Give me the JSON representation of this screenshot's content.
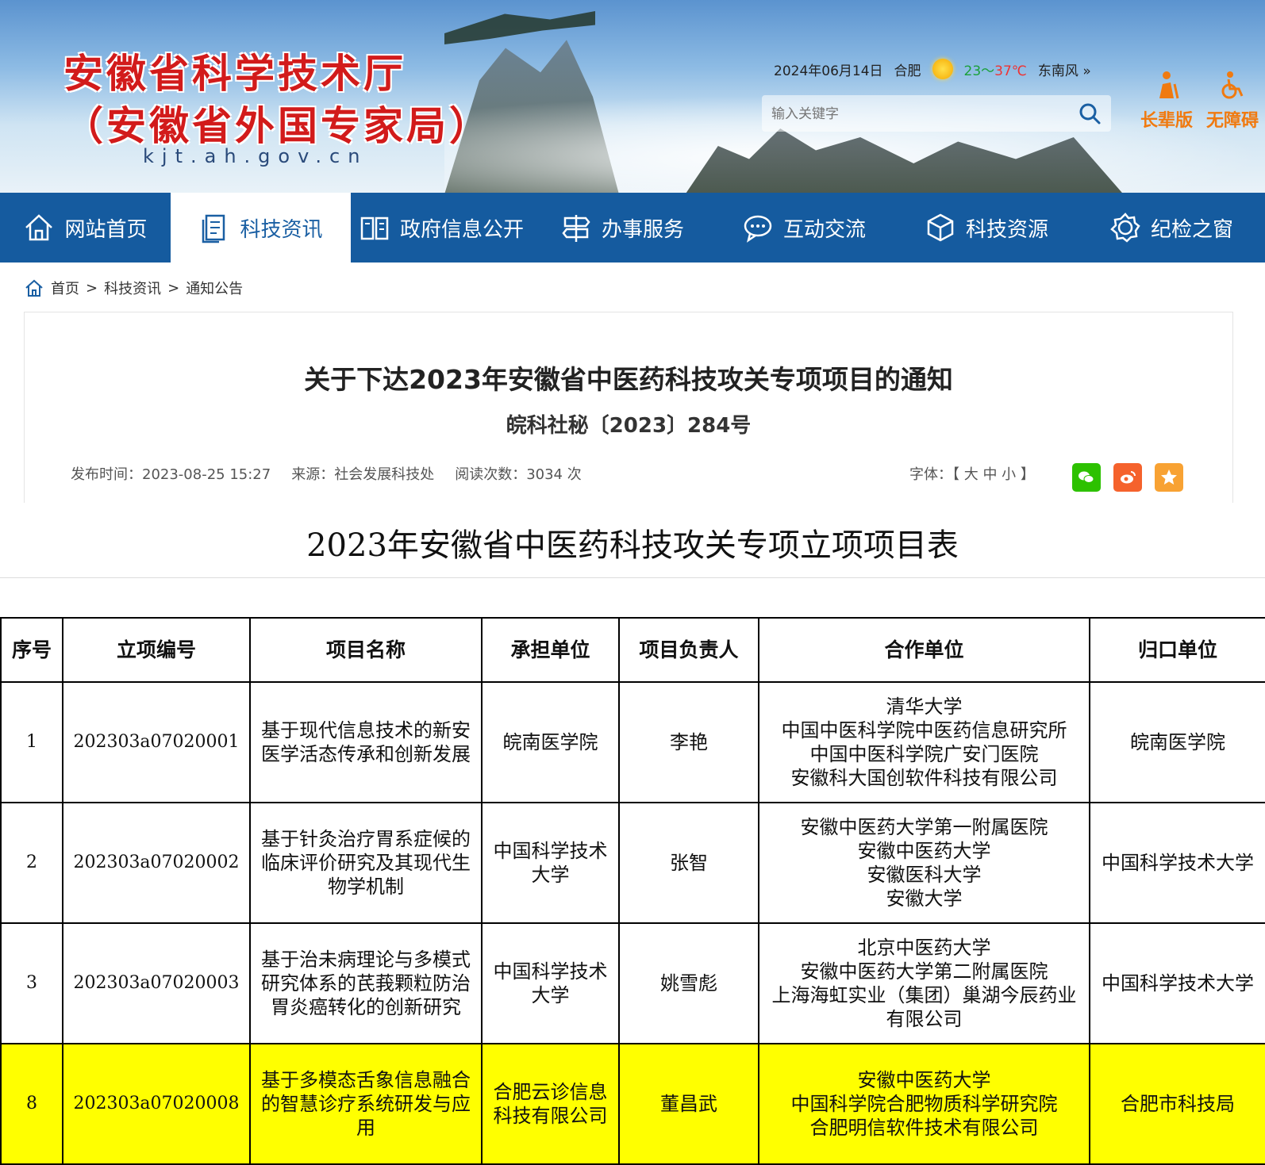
{
  "header": {
    "site_title_line1": "安徽省科学技术厅",
    "site_title_line2": "（安徽省外国专家局）",
    "domain": "kjt.ah.gov.cn",
    "date": "2024年06月14日",
    "city": "合肥",
    "temp_low": "23～",
    "temp_high": "37℃",
    "wind": "东南风",
    "wind_more": "»",
    "search_placeholder": "输入关键字",
    "elderly_label": "长辈版",
    "accessible_label": "无障碍"
  },
  "nav": {
    "items": [
      {
        "label": "网站首页",
        "icon": "home-icon"
      },
      {
        "label": "科技资讯",
        "icon": "document-icon"
      },
      {
        "label": "政府信息公开",
        "icon": "book-icon"
      },
      {
        "label": "办事服务",
        "icon": "signpost-icon"
      },
      {
        "label": "互动交流",
        "icon": "chat-icon"
      },
      {
        "label": "科技资源",
        "icon": "cube-icon"
      },
      {
        "label": "纪检之窗",
        "icon": "gear-badge-icon"
      }
    ],
    "active_index": 1
  },
  "breadcrumb": {
    "home": "首页",
    "sep": ">",
    "level1": "科技资讯",
    "level2": "通知公告"
  },
  "article": {
    "title": "关于下达2023年安徽省中医药科技攻关专项项目的通知",
    "doc_number": "皖科社秘〔2023〕284号",
    "publish_time": "发布时间：2023-08-25 15:27",
    "source": "来源：社会发展科技处",
    "read_count": "阅读次数：3034 次",
    "font_label": "字体：【 大 中 小 】",
    "share": {
      "wechat_color": "#2dc100",
      "weibo_color": "#f5622c",
      "favorite_color": "#f8a233"
    }
  },
  "table": {
    "title": "2023年安徽省中医药科技攻关专项立项项目表",
    "headers": [
      "序号",
      "立项编号",
      "项目名称",
      "承担单位",
      "项目负责人",
      "合作单位",
      "归口单位"
    ],
    "rows": [
      {
        "no": "1",
        "code": "202303a07020001",
        "name": "基于现代信息技术的新安医学活态传承和创新发展",
        "unit": "皖南医学院",
        "leader": "李艳",
        "partners": [
          "清华大学",
          "中国中医科学院中医药信息研究所",
          "中国中医科学院广安门医院",
          "安徽科大国创软件科技有限公司"
        ],
        "dept": "皖南医学院"
      },
      {
        "no": "2",
        "code": "202303a07020002",
        "name": "基于针灸治疗胃系症候的临床评价研究及其现代生物学机制",
        "unit": "中国科学技术大学",
        "leader": "张智",
        "partners": [
          "安徽中医药大学第一附属医院",
          "安徽中医药大学",
          "安徽医科大学",
          "安徽大学"
        ],
        "dept": "中国科学技术大学"
      },
      {
        "no": "3",
        "code": "202303a07020003",
        "name": "基于治未病理论与多模式研究体系的芪莪颗粒防治胃炎癌转化的创新研究",
        "unit": "中国科学技术大学",
        "leader": "姚雪彪",
        "partners": [
          "北京中医药大学",
          "安徽中医药大学第二附属医院",
          "上海海虹实业（集团）巢湖今辰药业有限公司"
        ],
        "dept": "中国科学技术大学"
      },
      {
        "no": "8",
        "code": "202303a07020008",
        "name": "基于多模态舌象信息融合的智慧诊疗系统研发与应用",
        "unit": "合肥云诊信息科技有限公司",
        "leader": "董昌武",
        "partners": [
          "安徽中医药大学",
          "中国科学院合肥物质科学研究院",
          "合肥明信软件技术有限公司"
        ],
        "dept": "合肥市科技局",
        "highlight_color": "#ffff00"
      }
    ]
  }
}
